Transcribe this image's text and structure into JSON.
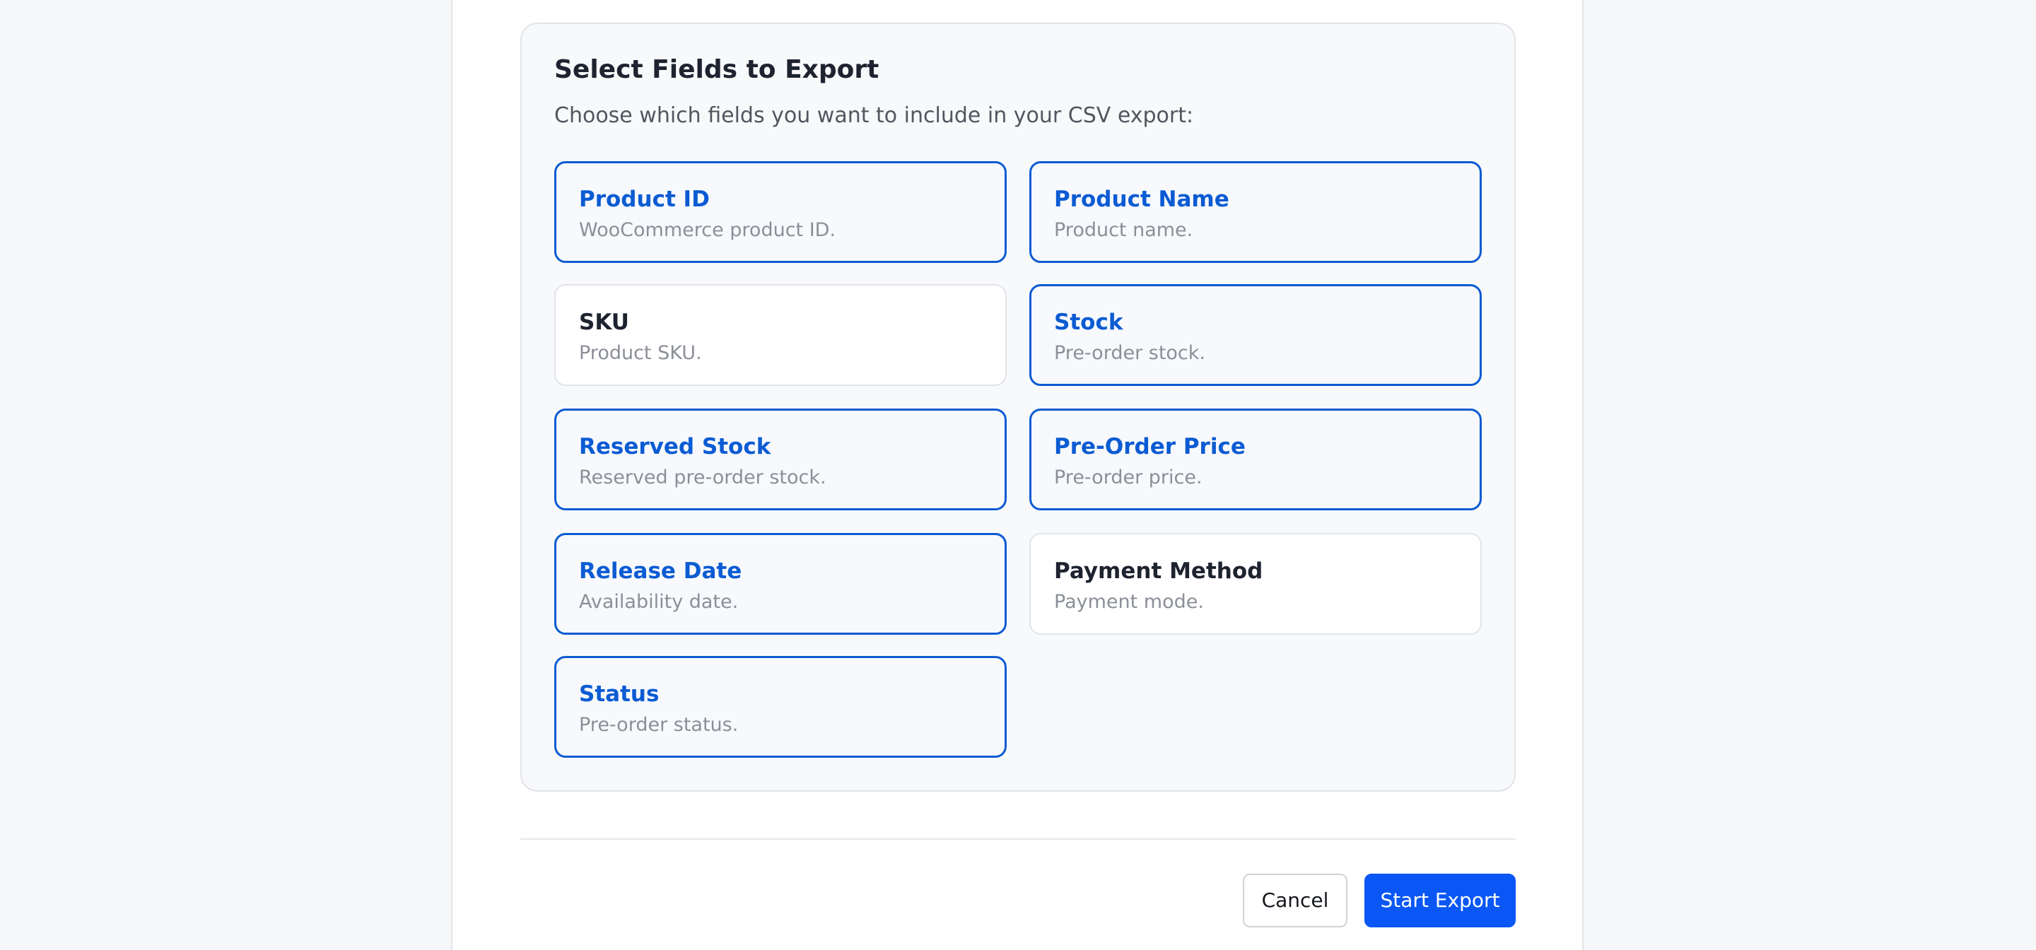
{
  "export_fields": {
    "title": "Select Fields to Export",
    "subtitle": "Choose which fields you want to include in your CSV export:",
    "fields": [
      {
        "label": "Product ID",
        "description": "WooCommerce product ID.",
        "selected": true
      },
      {
        "label": "Product Name",
        "description": "Product name.",
        "selected": true
      },
      {
        "label": "SKU",
        "description": "Product SKU.",
        "selected": false
      },
      {
        "label": "Stock",
        "description": "Pre-order stock.",
        "selected": true
      },
      {
        "label": "Reserved Stock",
        "description": "Reserved pre-order stock.",
        "selected": true
      },
      {
        "label": "Pre-Order Price",
        "description": "Pre-order price.",
        "selected": true
      },
      {
        "label": "Release Date",
        "description": "Availability date.",
        "selected": true
      },
      {
        "label": "Payment Method",
        "description": "Payment mode.",
        "selected": false
      },
      {
        "label": "Status",
        "description": "Pre-order status.",
        "selected": true
      }
    ]
  },
  "footer": {
    "cancel_label": "Cancel",
    "start_label": "Start Export"
  },
  "colors": {
    "accent": "#0b5bd3",
    "primary_button": "#0a57f5"
  }
}
